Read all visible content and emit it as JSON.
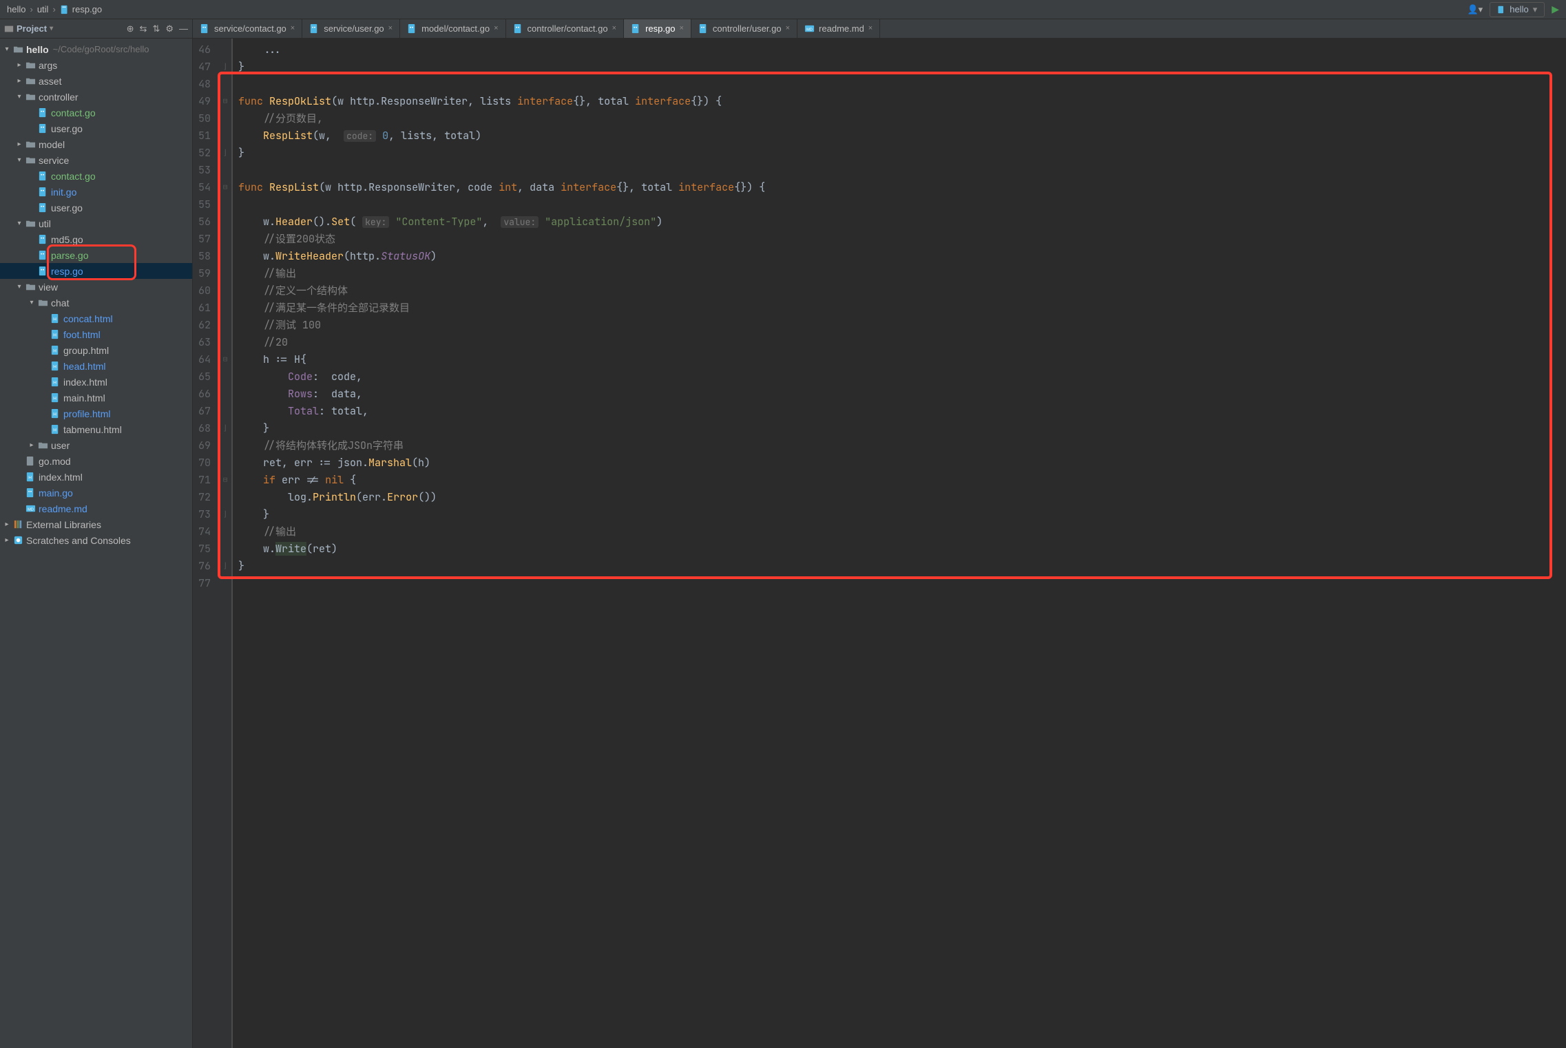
{
  "breadcrumb": {
    "root": "hello",
    "mid": "util",
    "file": "resp.go"
  },
  "runConfig": "hello",
  "sidebar": {
    "title": "Project",
    "root": {
      "name": "hello",
      "path": "~/Code/goRoot/src/hello"
    },
    "tree": [
      {
        "name": "args",
        "type": "folder",
        "arrow": "right"
      },
      {
        "name": "asset",
        "type": "folder",
        "arrow": "right"
      },
      {
        "name": "controller",
        "type": "folder",
        "arrow": "down",
        "children": [
          {
            "name": "contact.go",
            "type": "go",
            "cls": "green"
          },
          {
            "name": "user.go",
            "type": "go"
          }
        ]
      },
      {
        "name": "model",
        "type": "folder",
        "arrow": "right"
      },
      {
        "name": "service",
        "type": "folder",
        "arrow": "down",
        "children": [
          {
            "name": "contact.go",
            "type": "go",
            "cls": "green"
          },
          {
            "name": "init.go",
            "type": "go",
            "cls": "blue"
          },
          {
            "name": "user.go",
            "type": "go"
          }
        ]
      },
      {
        "name": "util",
        "type": "folder",
        "arrow": "down",
        "children": [
          {
            "name": "md5.go",
            "type": "go"
          },
          {
            "name": "parse.go",
            "type": "go",
            "cls": "green",
            "boxed": true
          },
          {
            "name": "resp.go",
            "type": "go",
            "cls": "blue",
            "selected": true,
            "boxed": true
          }
        ]
      },
      {
        "name": "view",
        "type": "folder",
        "arrow": "down",
        "children": [
          {
            "name": "chat",
            "type": "folder",
            "arrow": "down",
            "children": [
              {
                "name": "concat.html",
                "type": "html",
                "cls": "blue"
              },
              {
                "name": "foot.html",
                "type": "html",
                "cls": "blue"
              },
              {
                "name": "group.html",
                "type": "html"
              },
              {
                "name": "head.html",
                "type": "html",
                "cls": "blue"
              },
              {
                "name": "index.html",
                "type": "html"
              },
              {
                "name": "main.html",
                "type": "html"
              },
              {
                "name": "profile.html",
                "type": "html",
                "cls": "blue"
              },
              {
                "name": "tabmenu.html",
                "type": "html"
              }
            ]
          },
          {
            "name": "user",
            "type": "folder",
            "arrow": "right"
          }
        ]
      },
      {
        "name": "go.mod",
        "type": "mod"
      },
      {
        "name": "index.html",
        "type": "html"
      },
      {
        "name": "main.go",
        "type": "go",
        "cls": "blue"
      },
      {
        "name": "readme.md",
        "type": "md",
        "cls": "blue"
      }
    ],
    "extLibs": "External Libraries",
    "scratches": "Scratches and Consoles"
  },
  "tabs": [
    {
      "label": "service/contact.go",
      "active": false
    },
    {
      "label": "service/user.go",
      "active": false
    },
    {
      "label": "model/contact.go",
      "active": false
    },
    {
      "label": "controller/contact.go",
      "active": false
    },
    {
      "label": "resp.go",
      "active": true
    },
    {
      "label": "controller/user.go",
      "active": false
    },
    {
      "label": "readme.md",
      "active": false,
      "md": true
    }
  ],
  "code": {
    "firstLine": 46,
    "lines": [
      {
        "html": "    ...<span class='ident'></span>"
      },
      {
        "html": "}"
      },
      {
        "html": ""
      },
      {
        "html": "<span class='kw'>func</span> <span class='fn'>RespOkList</span>(w http.<span class='type2'>ResponseWriter</span>, lists <span class='kw'>interface</span>{}, total <span class='kw'>interface</span>{}) {"
      },
      {
        "html": "    <span class='cmt'>//分页数目,</span>"
      },
      {
        "html": "    <span class='fn'>RespList</span>(w,  <span class='param-hint'>code:</span> <span class='num'>0</span>, lists, total)"
      },
      {
        "html": "}"
      },
      {
        "html": ""
      },
      {
        "html": "<span class='kw'>func</span> <span class='fn'>RespList</span>(w http.<span class='type2'>ResponseWriter</span>, code <span class='kw'>int</span>, data <span class='kw'>interface</span>{}, total <span class='kw'>interface</span>{}) {"
      },
      {
        "html": ""
      },
      {
        "html": "    w.<span class='fn'>Header</span>().<span class='fn'>Set</span>( <span class='param-hint'>key:</span> <span class='str'>\"Content-Type\"</span>,  <span class='param-hint'>value:</span> <span class='str'>\"application/json\"</span>)"
      },
      {
        "html": "    <span class='cmt'>//设置200状态</span>"
      },
      {
        "html": "    w.<span class='fn'>WriteHeader</span>(http.<span class='italic'>StatusOK</span>)"
      },
      {
        "html": "    <span class='cmt'>//输出</span>"
      },
      {
        "html": "    <span class='cmt'>//定义一个结构体</span>"
      },
      {
        "html": "    <span class='cmt'>//满足某一条件的全部记录数目</span>"
      },
      {
        "html": "    <span class='cmt'>//测试 100</span>"
      },
      {
        "html": "    <span class='cmt'>//20</span>"
      },
      {
        "html": "    h := <span class='type2'>H</span>{"
      },
      {
        "html": "        <span class='field'>Code</span>:  code,"
      },
      {
        "html": "        <span class='field'>Rows</span>:  data,"
      },
      {
        "html": "        <span class='field'>Total</span>: total,"
      },
      {
        "html": "    }"
      },
      {
        "html": "    <span class='cmt'>//将结构体转化成JSOn字符串</span>"
      },
      {
        "html": "    ret, err := json.<span class='fn'>Marshal</span>(h)"
      },
      {
        "html": "    <span class='kw'>if</span> err != <span class='kw'>nil</span> {"
      },
      {
        "html": "        log.<span class='fn'>Println</span>(err.<span class='fn'>Error</span>())"
      },
      {
        "html": "    }"
      },
      {
        "html": "    <span class='cmt'>//输出</span>"
      },
      {
        "html": "    w.<span class='hl'>Write</span>(ret)"
      },
      {
        "html": "}"
      },
      {
        "html": ""
      }
    ]
  }
}
